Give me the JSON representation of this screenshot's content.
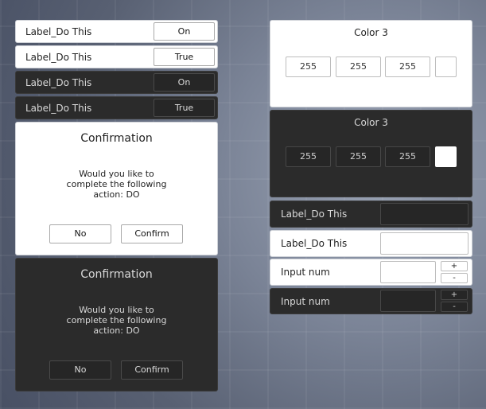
{
  "toggles": [
    {
      "label": "Label_Do This",
      "button": "On"
    },
    {
      "label": "Label_Do This",
      "button": "True"
    },
    {
      "label": "Label_Do This",
      "button": "On"
    },
    {
      "label": "Label_Do This",
      "button": "True"
    }
  ],
  "confirm_light": {
    "title": "Confirmation",
    "message_lines": [
      "Would you like to",
      "complete the following",
      "action: DO"
    ],
    "no": "No",
    "confirm": "Confirm"
  },
  "confirm_dark": {
    "title": "Confirmation",
    "message_lines": [
      "Would you like to",
      "complete the following",
      "action: DO"
    ],
    "no": "No",
    "confirm": "Confirm"
  },
  "color_light": {
    "title": "Color 3",
    "r": "255",
    "g": "255",
    "b": "255",
    "swatch": "#ffffff"
  },
  "color_dark": {
    "title": "Color 3",
    "r": "255",
    "g": "255",
    "b": "255",
    "swatch": "#ffffff"
  },
  "text_inputs": [
    {
      "label": "Label_Do This",
      "value": ""
    },
    {
      "label": "Label_Do This",
      "value": ""
    }
  ],
  "num_inputs": [
    {
      "label": "Input num",
      "value": "",
      "plus": "+",
      "minus": "-"
    },
    {
      "label": "Input num",
      "value": "",
      "plus": "+",
      "minus": "-"
    }
  ]
}
